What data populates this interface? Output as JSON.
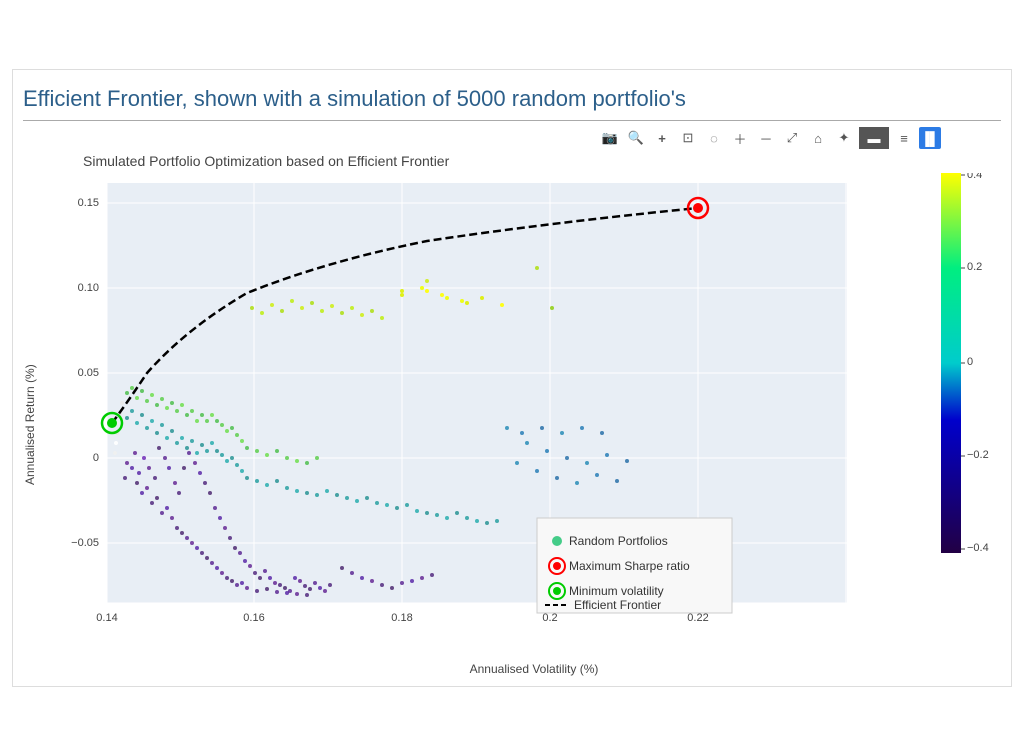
{
  "title": "Efficient Frontier, shown with a simulation of 5000 random portfolio's",
  "plot_title": "Simulated Portfolio Optimization based on Efficient Frontier",
  "x_axis_label": "Annualised Volatility (%)",
  "y_axis_label": "Annualised Return (%)",
  "toolbar": {
    "buttons": [
      "📷",
      "🔍",
      "+",
      "⊞",
      "💬",
      "➕",
      "➖",
      "⤢",
      "⌂",
      "✂",
      "◀",
      "▶",
      "📊"
    ]
  },
  "colorbar": {
    "labels": [
      "0.4",
      "0.2",
      "0",
      "-0.2",
      "-0.4"
    ]
  },
  "legend": {
    "random_portfolios": "Random Portfolios",
    "max_sharpe": "Maximum Sharpe ratio",
    "min_vol": "Minimum volatility",
    "frontier": "Efficient Frontier"
  },
  "x_ticks": [
    "0.14",
    "0.16",
    "0.18",
    "0.2",
    "0.22"
  ],
  "y_ticks": [
    "0.15",
    "0.10",
    "0.05",
    "0",
    "-0.05"
  ]
}
